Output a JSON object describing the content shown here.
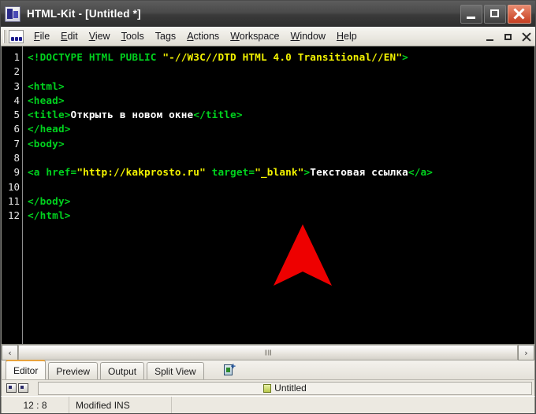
{
  "window": {
    "title": "HTML-Kit - [Untitled *]",
    "app_icon": "html-kit-icon",
    "controls": {
      "minimize": "minimize-icon",
      "maximize": "maximize-icon",
      "close": "close-icon"
    }
  },
  "menubar": {
    "toolbar_icon": "html-kit-toolbar-icon",
    "items": [
      {
        "label": "File",
        "mnemonic": "F"
      },
      {
        "label": "Edit",
        "mnemonic": "E"
      },
      {
        "label": "View",
        "mnemonic": "V"
      },
      {
        "label": "Tools",
        "mnemonic": "T"
      },
      {
        "label": "Tags",
        "mnemonic": ""
      },
      {
        "label": "Actions",
        "mnemonic": "A"
      },
      {
        "label": "Workspace",
        "mnemonic": "W"
      },
      {
        "label": "Window",
        "mnemonic": "W"
      },
      {
        "label": "Help",
        "mnemonic": "H"
      }
    ],
    "mdi_controls": {
      "minimize": "mdi-minimize-icon",
      "restore": "mdi-restore-icon",
      "close": "mdi-close-icon"
    }
  },
  "editor": {
    "background": "#000000",
    "gutter_color": "#e8e8e8",
    "colors": {
      "tag": "#00d21e",
      "string": "#f2f200",
      "text": "#ffffff"
    },
    "line_numbers": [
      "1",
      "2",
      "3",
      "4",
      "5",
      "6",
      "7",
      "8",
      "9",
      "10",
      "11",
      "12"
    ],
    "lines": [
      {
        "n": 1,
        "tokens": [
          {
            "t": "tag",
            "v": "<!DOCTYPE HTML PUBLIC "
          },
          {
            "t": "str",
            "v": "\"-//W3C//DTD HTML 4.0 Transitional//EN\""
          },
          {
            "t": "tag",
            "v": ">"
          }
        ]
      },
      {
        "n": 2,
        "tokens": []
      },
      {
        "n": 3,
        "tokens": [
          {
            "t": "tag",
            "v": "<html>"
          }
        ]
      },
      {
        "n": 4,
        "tokens": [
          {
            "t": "tag",
            "v": "<head>"
          }
        ]
      },
      {
        "n": 5,
        "tokens": [
          {
            "t": "tag",
            "v": "<title>"
          },
          {
            "t": "text",
            "v": "Открыть в новом окне"
          },
          {
            "t": "tag",
            "v": "</title>"
          }
        ]
      },
      {
        "n": 6,
        "tokens": [
          {
            "t": "tag",
            "v": "</head>"
          }
        ]
      },
      {
        "n": 7,
        "tokens": [
          {
            "t": "tag",
            "v": "<body>"
          }
        ]
      },
      {
        "n": 8,
        "tokens": []
      },
      {
        "n": 9,
        "tokens": [
          {
            "t": "tag",
            "v": "<a href="
          },
          {
            "t": "str",
            "v": "\"http://kakprosto.ru\""
          },
          {
            "t": "tag",
            "v": " target="
          },
          {
            "t": "str",
            "v": "\"_blank\""
          },
          {
            "t": "tag",
            "v": ">"
          },
          {
            "t": "text",
            "v": "Текстовая ссылка"
          },
          {
            "t": "tag",
            "v": "</a>"
          }
        ]
      },
      {
        "n": 10,
        "tokens": []
      },
      {
        "n": 11,
        "tokens": [
          {
            "t": "tag",
            "v": "</body>"
          }
        ]
      },
      {
        "n": 12,
        "tokens": [
          {
            "t": "tag",
            "v": "</html>"
          }
        ]
      }
    ],
    "cursor_overlay": {
      "name": "red-arrow-pointer",
      "color": "#ee0000"
    }
  },
  "scrollbar": {
    "left_arrow": "‹",
    "right_arrow": "›"
  },
  "tabs": [
    {
      "label": "Editor",
      "active": true
    },
    {
      "label": "Preview",
      "active": false
    },
    {
      "label": "Output",
      "active": false
    },
    {
      "label": "Split View",
      "active": false
    }
  ],
  "tab_tool_icon": "new-document-icon",
  "docbar": {
    "document_name": "Untitled",
    "document_icon": "document-icon"
  },
  "statusbar": {
    "position": "12 : 8",
    "mode": "Modified INS",
    "extra": ""
  }
}
